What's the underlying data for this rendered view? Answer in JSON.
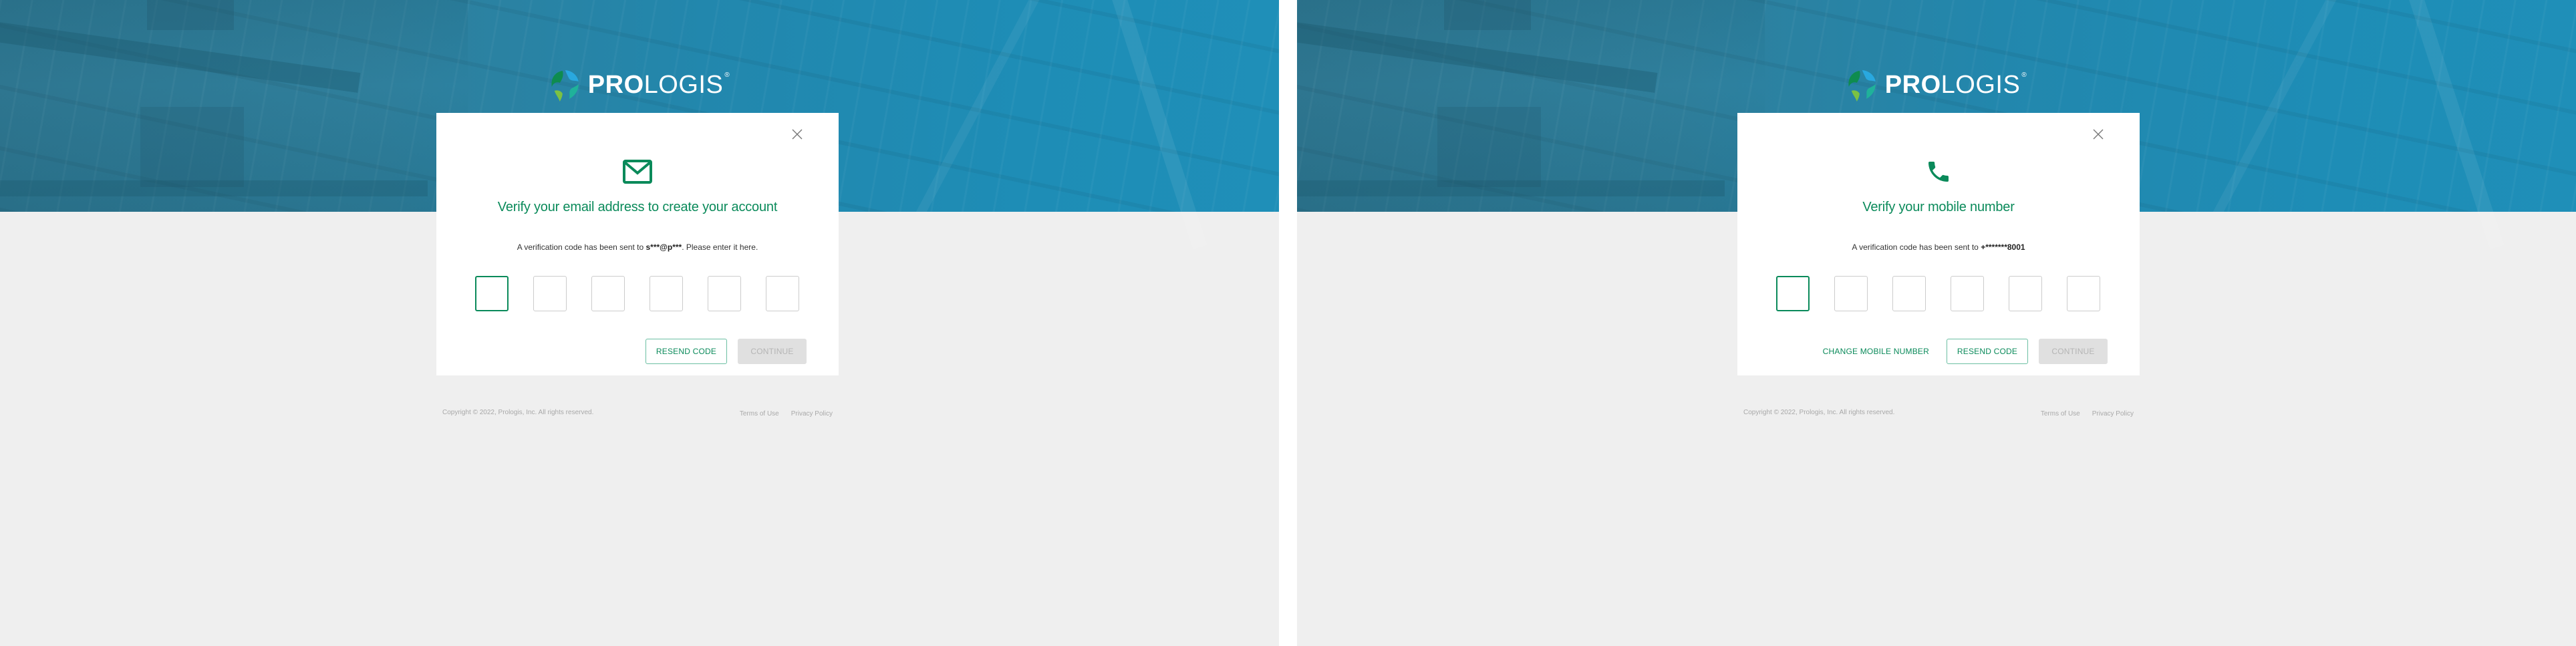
{
  "brand": {
    "name_bold": "PRO",
    "name_light": "LOGIS",
    "registered": "®",
    "primary_green": "#0a8a5a",
    "hero_blue": "#1e8db6"
  },
  "screens": [
    {
      "icon": "mail-icon",
      "title": "Verify your email address to create your account",
      "desc_prefix": "A verification code has been sent to ",
      "desc_target": "s***@p***",
      "desc_suffix": ". Please enter it here.",
      "code_inputs": [
        "",
        "",
        "",
        "",
        "",
        ""
      ],
      "active_input_index": 0,
      "buttons": {
        "resend": "RESEND CODE",
        "continue": "CONTINUE"
      }
    },
    {
      "icon": "phone-icon",
      "title": "Verify your mobile number",
      "desc_prefix": "A verification code has been sent to ",
      "desc_target": "+*******8001",
      "desc_suffix": "",
      "code_inputs": [
        "",
        "",
        "",
        "",
        "",
        ""
      ],
      "active_input_index": 0,
      "buttons": {
        "change": "CHANGE MOBILE NUMBER",
        "resend": "RESEND CODE",
        "continue": "CONTINUE"
      }
    }
  ],
  "footer": {
    "copyright": "Copyright © 2022, Prologis, Inc. All rights reserved.",
    "terms": "Terms of Use",
    "privacy": "Privacy Policy"
  }
}
